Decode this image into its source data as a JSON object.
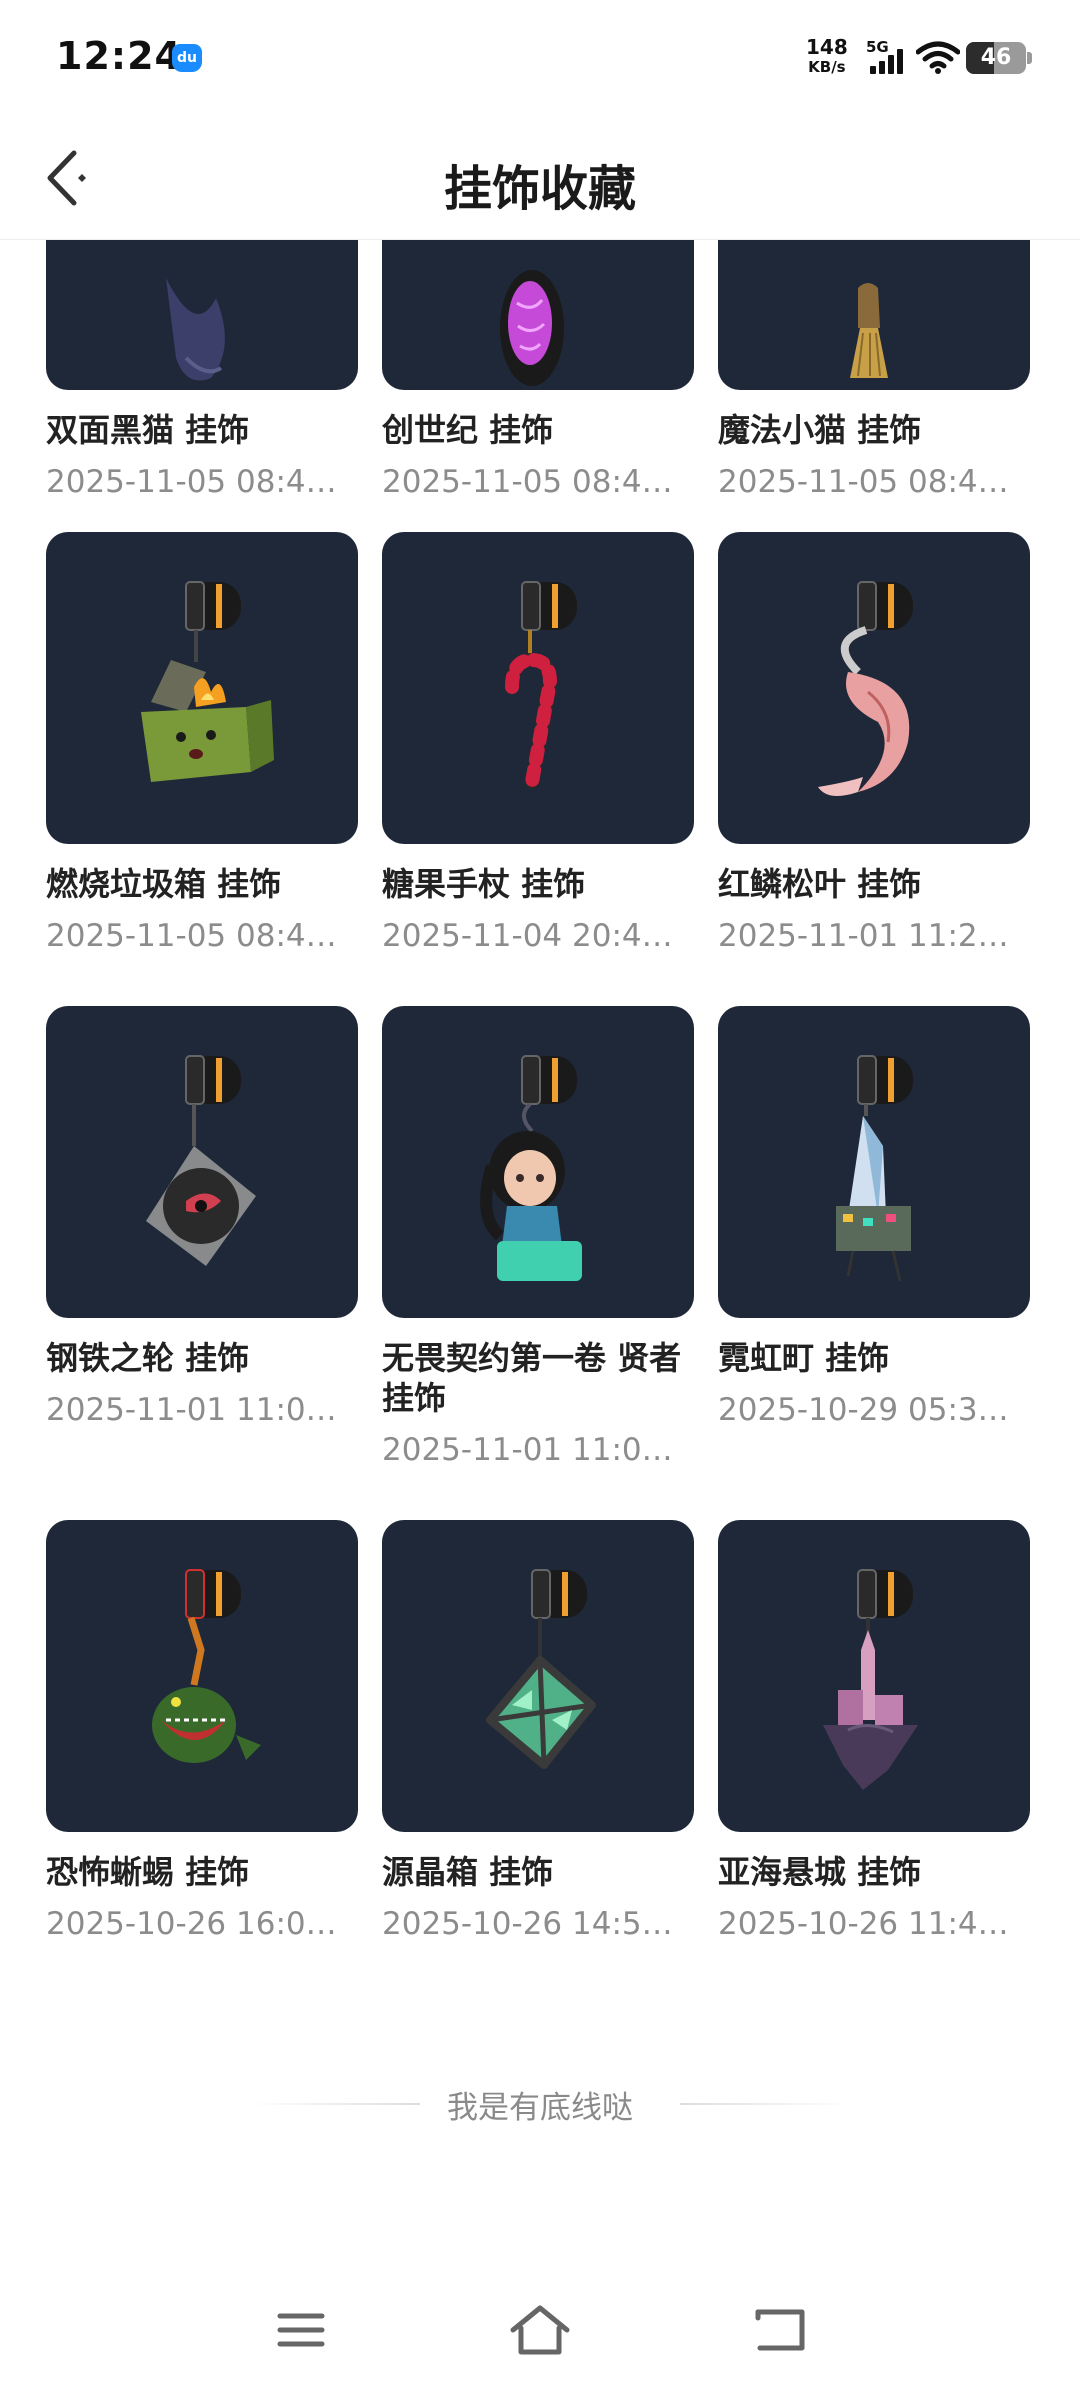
{
  "status_bar": {
    "time": "12:24",
    "app_notification_icon": "app-badge-icon",
    "net_speed_value": "148",
    "net_speed_unit": "KB/s",
    "network_type": "5G",
    "battery_level": "46"
  },
  "header": {
    "title": "挂饰收藏",
    "back_icon": "chevron-left-icon"
  },
  "items": [
    {
      "name": " 双面黑猫 挂饰",
      "date": "2025-11-05 08:4…",
      "icon": "black-cat-charm-icon"
    },
    {
      "name": "创世纪 挂饰",
      "date": "2025-11-05 08:4…",
      "icon": "genesis-charm-icon"
    },
    {
      "name": "魔法小猫 挂饰",
      "date": "2025-11-05 08:4…",
      "icon": "magic-kitten-charm-icon"
    },
    {
      "name": "燃烧垃圾箱 挂饰",
      "date": "2025-11-05 08:4…",
      "icon": "burning-dumpster-charm-icon"
    },
    {
      "name": "糖果手杖 挂饰",
      "date": "2025-11-04 20:4…",
      "icon": "candy-cane-charm-icon"
    },
    {
      "name": "红鳞松叶 挂饰",
      "date": "2025-11-01 11:2…",
      "icon": "red-koi-charm-icon"
    },
    {
      "name": "钢铁之轮 挂饰",
      "date": "2025-11-01 11:0…",
      "icon": "turntable-charm-icon"
    },
    {
      "name": "无畏契约第一卷 贤者 挂饰",
      "date": "2025-11-01 11:0…",
      "icon": "sage-figure-charm-icon"
    },
    {
      "name": "霓虹町 挂饰",
      "date": "2025-10-29 05:3…",
      "icon": "neon-city-charm-icon"
    },
    {
      "name": "恐怖蜥蜴 挂饰",
      "date": "2025-10-26 16:0…",
      "icon": "lizard-charm-icon"
    },
    {
      "name": "源晶箱 挂饰",
      "date": "2025-10-26 14:5…",
      "icon": "crystal-box-charm-icon"
    },
    {
      "name": "亚海悬城 挂饰",
      "date": "2025-10-26 11:4…",
      "icon": "floating-castle-charm-icon"
    }
  ],
  "footer": {
    "end_text": "我是有底线哒"
  },
  "nav_bar": {
    "menu_icon": "menu-icon",
    "home_icon": "home-icon",
    "back_icon": "back-icon"
  },
  "colors": {
    "thumb_bg": "#1e2838",
    "date_text": "#8c8c8c",
    "accent_orange": "#f0a030"
  }
}
